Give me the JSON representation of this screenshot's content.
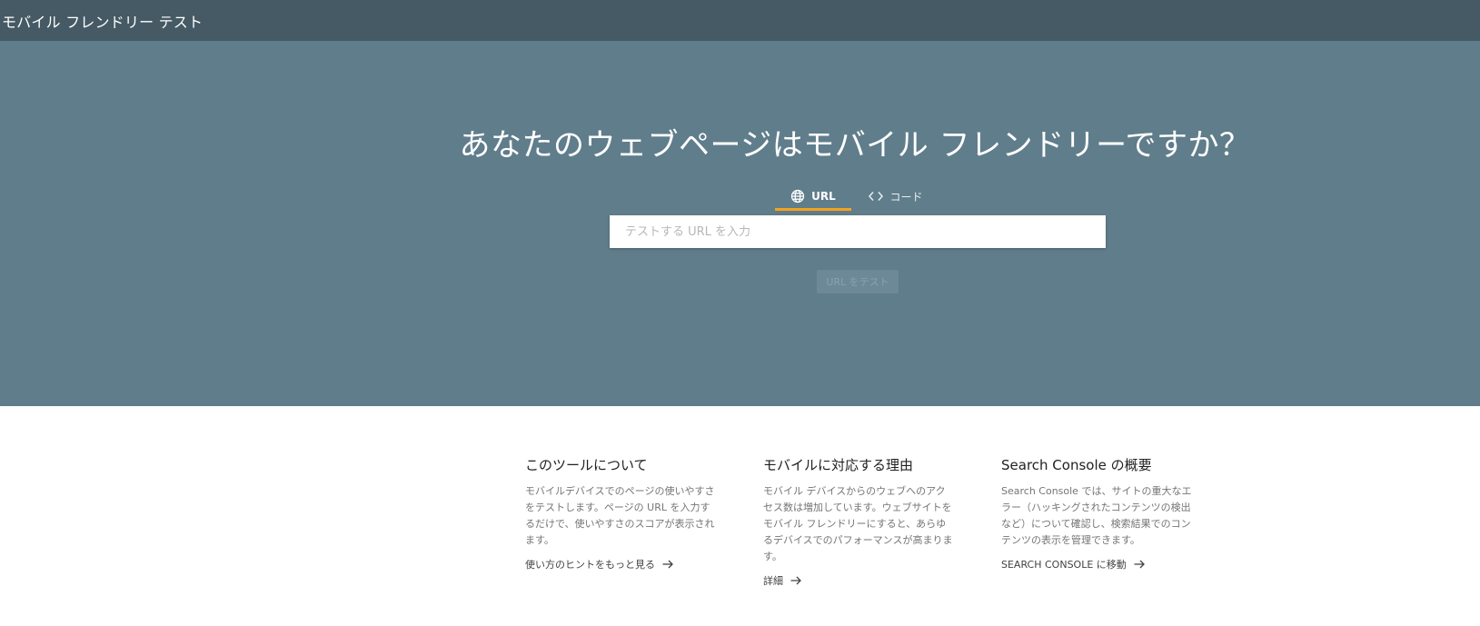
{
  "header": {
    "title": "モバイル フレンドリー テスト"
  },
  "hero": {
    "headline": "あなたのウェブページはモバイル フレンドリーですか？",
    "tabs": [
      {
        "label": "URL",
        "icon": "globe-icon",
        "active": true
      },
      {
        "label": "コード",
        "icon": "code-icon",
        "active": false
      }
    ],
    "input": {
      "placeholder": "テストする URL を入力",
      "value": ""
    },
    "test_button": "URL をテスト"
  },
  "info": [
    {
      "title": "このツールについて",
      "body": "モバイルデバイスでのページの使いやすさをテストします。ページの URL を入力するだけで、使いやすさのスコアが表示されます。",
      "link": "使い方のヒントをもっと見る"
    },
    {
      "title": "モバイルに対応する理由",
      "body": "モバイル デバイスからのウェブへのアクセス数は増加しています。ウェブサイトをモバイル フレンドリーにすると、あらゆるデバイスでのパフォーマンスが高まります。",
      "link": "詳細"
    },
    {
      "title": "Search Console の概要",
      "body": "Search Console では、サイトの重大なエラー（ハッキングされたコンテンツの検出など）について確認し、検索結果でのコンテンツの表示を管理できます。",
      "link": "SEARCH CONSOLE に移動"
    }
  ],
  "colors": {
    "topbar": "#455a64",
    "hero": "#607d8b",
    "tab_indicator": "#f4a21f"
  }
}
